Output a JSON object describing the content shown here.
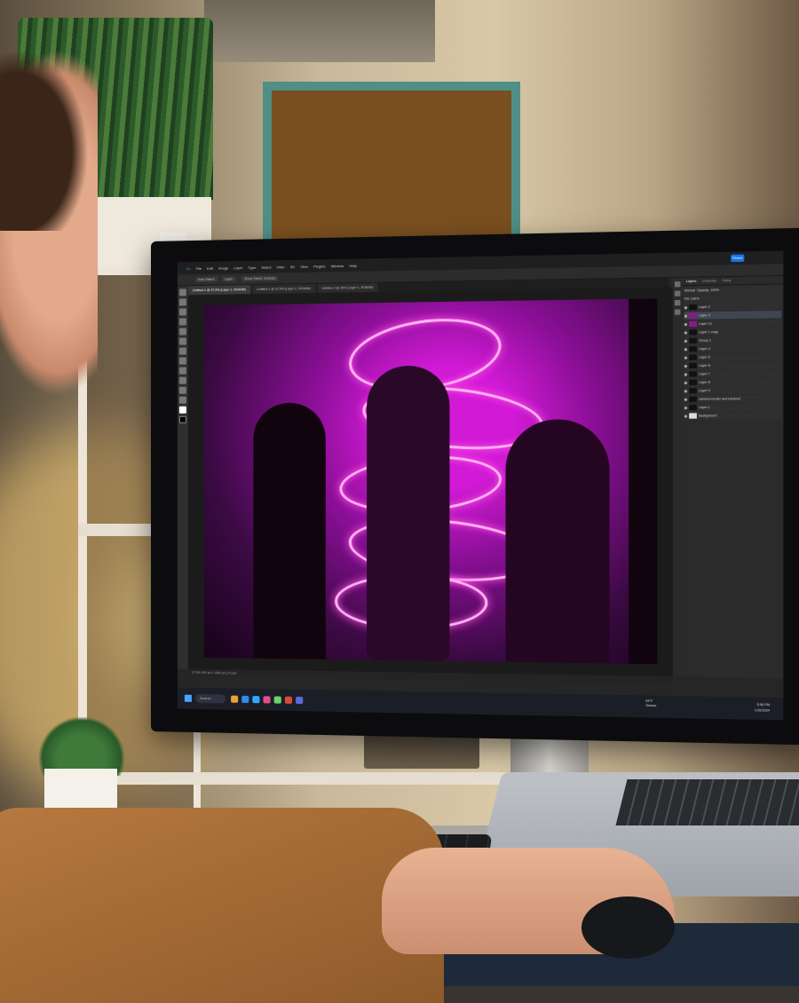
{
  "photoshop": {
    "menu": [
      "File",
      "Edit",
      "Image",
      "Layer",
      "Type",
      "Select",
      "Filter",
      "3D",
      "View",
      "Plugins",
      "Window",
      "Help"
    ],
    "share_label": "Share",
    "options": [
      "Auto-Select:",
      "Layer",
      "Show Transf. Controls"
    ],
    "tabs": [
      "Untitled-1 @ 37.5% (Layer 1, RGB/8#)",
      "Untitled-1 @ 37.5% (Layer 2, RGB/8#)",
      "Untitled-2 @ 25% (Layer 1, RGB/8#)"
    ],
    "layers_panel_tabs": [
      "Layers",
      "Channels",
      "Paths"
    ],
    "blend_mode": "Normal",
    "opacity_label": "Opacity: 100%",
    "fill_label": "Fill: 100%",
    "layers": [
      {
        "name": "Layer 2",
        "thumb": "dark"
      },
      {
        "name": "Layer 3",
        "thumb": "pink",
        "selected": true
      },
      {
        "name": "Layer 12",
        "thumb": "pink"
      },
      {
        "name": "Layer 1 copy",
        "thumb": "dark"
      },
      {
        "name": "Group 1",
        "thumb": "dark"
      },
      {
        "name": "Layer 4",
        "thumb": "dark"
      },
      {
        "name": "Layer 5",
        "thumb": "dark"
      },
      {
        "name": "Layer 6",
        "thumb": "dark"
      },
      {
        "name": "Layer 7",
        "thumb": "dark"
      },
      {
        "name": "Layer 8",
        "thumb": "dark"
      },
      {
        "name": "Layer 9",
        "thumb": "dark"
      },
      {
        "name": "camera border and backout",
        "thumb": "dark"
      },
      {
        "name": "Layer 1",
        "thumb": "dark"
      },
      {
        "name": "Background",
        "thumb": "white"
      }
    ],
    "status": "37.5%    900 px x 1080 px (72 ppi)"
  },
  "taskbar": {
    "search_label": "Search",
    "weather_temp": "84°F",
    "weather_desc": "Smoke",
    "time": "5:56 PM",
    "date": "1/16/2024"
  },
  "colors": {
    "ps_accent": "#1473e6",
    "neon": "#ff4fe6",
    "photo_bg": "#8a0f96"
  }
}
